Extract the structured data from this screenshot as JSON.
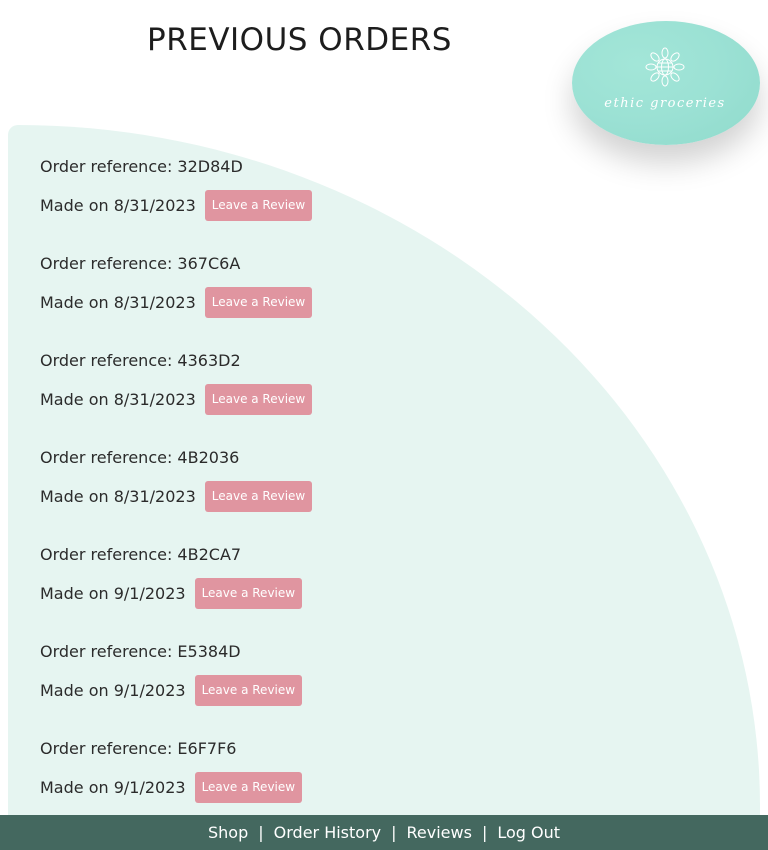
{
  "header": {
    "title": "PREVIOUS ORDERS"
  },
  "logo": {
    "text": "ethic groceries",
    "icon": "globe-sunflower-icon"
  },
  "orders": [
    {
      "reference": "Order reference: 32D84D",
      "date": "Made on 8/31/2023",
      "button": "Leave a Review"
    },
    {
      "reference": "Order reference: 367C6A",
      "date": "Made on 8/31/2023",
      "button": "Leave a Review"
    },
    {
      "reference": "Order reference: 4363D2",
      "date": "Made on 8/31/2023",
      "button": "Leave a Review"
    },
    {
      "reference": "Order reference: 4B2036",
      "date": "Made on 8/31/2023",
      "button": "Leave a Review"
    },
    {
      "reference": "Order reference: 4B2CA7",
      "date": "Made on 9/1/2023",
      "button": "Leave a Review"
    },
    {
      "reference": "Order reference: E5384D",
      "date": "Made on 9/1/2023",
      "button": "Leave a Review"
    },
    {
      "reference": "Order reference: E6F7F6",
      "date": "Made on 9/1/2023",
      "button": "Leave a Review"
    }
  ],
  "footer": {
    "links": [
      "Shop",
      "Order History",
      "Reviews",
      "Log Out"
    ],
    "separator": "|"
  },
  "colors": {
    "panel": "#e6f5f1",
    "button": "#e095a0",
    "footer": "#44685f",
    "logo": "#9be1d4"
  }
}
